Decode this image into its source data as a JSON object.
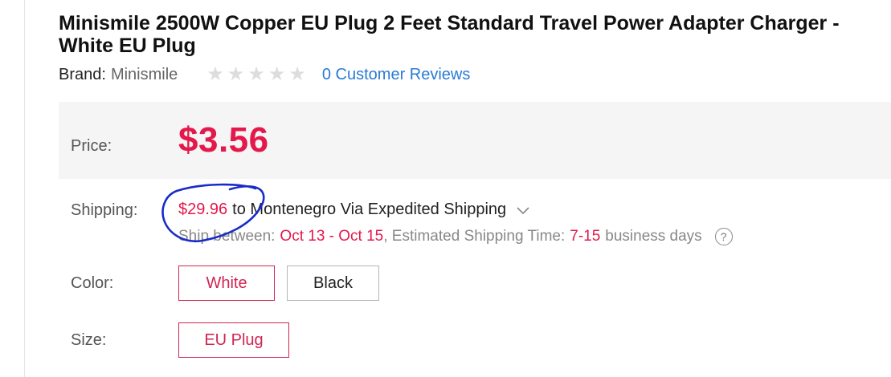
{
  "product": {
    "title": "Minismile 2500W Copper EU Plug 2 Feet Standard Travel Power Adapter Charger - White EU Plug",
    "brand_label": "Brand:",
    "brand_value": "Minismile",
    "rating": 0,
    "rating_max": 5,
    "reviews_link": "0 Customer Reviews"
  },
  "price": {
    "label": "Price:",
    "value": "$3.56"
  },
  "shipping": {
    "label": "Shipping:",
    "cost": "$29.96",
    "destination_text": "to Montenegro Via Expedited Shipping",
    "ship_between_label": "Ship between:",
    "ship_between_value": "Oct 13 - Oct 15",
    "estimated_label": ", Estimated Shipping Time:",
    "estimated_value": "7-15",
    "estimated_unit": "business days",
    "help_symbol": "?"
  },
  "color": {
    "label": "Color:",
    "options": [
      "White",
      "Black"
    ],
    "selected": "White"
  },
  "size": {
    "label": "Size:",
    "options": [
      "EU Plug"
    ],
    "selected": "EU Plug"
  },
  "colors": {
    "price_red": "#e4184a",
    "link_blue": "#2a7ad6",
    "panel_gray": "#f5f5f5",
    "annotation_blue": "#1a2cc8"
  },
  "icons": {
    "star": "star-icon",
    "chevron": "chevron-down-icon",
    "help": "question-circle-icon"
  }
}
